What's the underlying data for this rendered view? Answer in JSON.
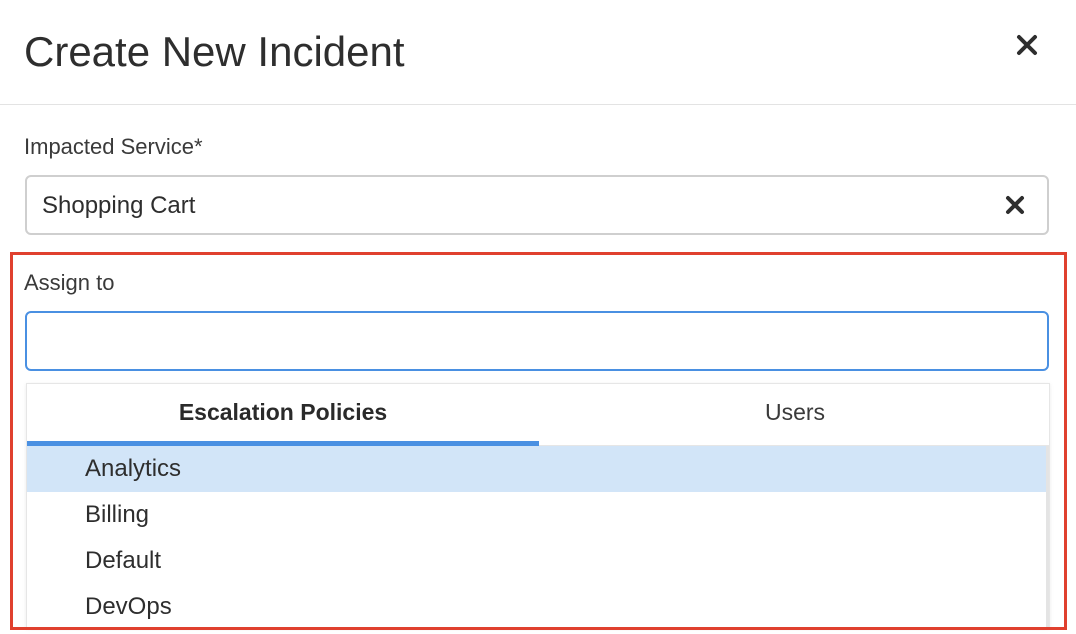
{
  "modal": {
    "title": "Create New Incident",
    "close_icon": "close-icon"
  },
  "impacted_service": {
    "label": "Impacted Service*",
    "value": "Shopping Cart",
    "clear_icon": "clear-icon"
  },
  "assign_to": {
    "label": "Assign to",
    "value": "",
    "placeholder": ""
  },
  "dropdown": {
    "tabs": [
      {
        "label": "Escalation Policies",
        "active": true
      },
      {
        "label": "Users",
        "active": false
      }
    ],
    "options": [
      {
        "label": "Analytics",
        "highlighted": true
      },
      {
        "label": "Billing",
        "highlighted": false
      },
      {
        "label": "Default",
        "highlighted": false
      },
      {
        "label": "DevOps",
        "highlighted": false
      }
    ]
  },
  "colors": {
    "accent": "#4a90e2",
    "highlighted_option": "#d2e5f8",
    "annotation_outline": "#e0402e"
  }
}
